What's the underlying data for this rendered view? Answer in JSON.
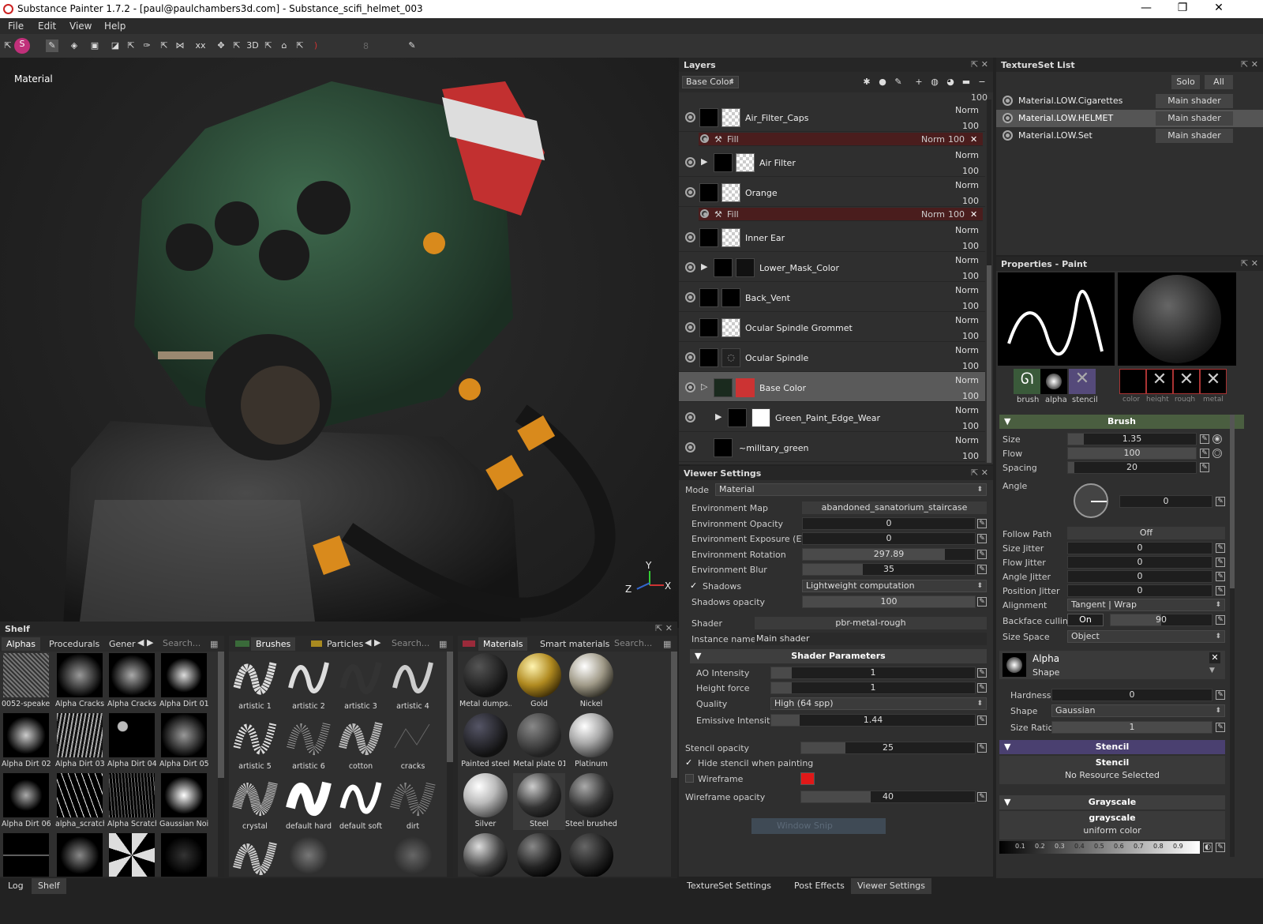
{
  "window": {
    "title": "Substance Painter 1.7.2 - [paul@paulchambers3d.com] - Substance_scifi_helmet_003",
    "minimize": "—",
    "maximize": "❐",
    "close": "✕"
  },
  "menu": [
    "File",
    "Edit",
    "View",
    "Help"
  ],
  "toolbar": {
    "brush_size_value": "8"
  },
  "viewport": {
    "label": "Material",
    "axes": {
      "x": "X",
      "y": "Y",
      "z": "Z"
    }
  },
  "layers": {
    "title": "Layers",
    "channel": "Base Color",
    "top_value": "100",
    "items": [
      {
        "name": "Air_Filter_Caps",
        "blend": "Norm",
        "opacity": "100",
        "fill": {
          "label": "Fill",
          "blend": "Norm",
          "opacity": "100"
        }
      },
      {
        "name": "Air Filter",
        "blend": "Norm",
        "opacity": "100",
        "folder": true
      },
      {
        "name": "Orange",
        "blend": "Norm",
        "opacity": "100",
        "fill": {
          "label": "Fill",
          "blend": "Norm",
          "opacity": "100"
        }
      },
      {
        "name": "Inner Ear",
        "blend": "Norm",
        "opacity": "100"
      },
      {
        "name": "Lower_Mask_Color",
        "blend": "Norm",
        "opacity": "100",
        "folder": true
      },
      {
        "name": "Back_Vent",
        "blend": "Norm",
        "opacity": "100"
      },
      {
        "name": "Ocular Spindle Grommet",
        "blend": "Norm",
        "opacity": "100"
      },
      {
        "name": "Ocular Spindle",
        "blend": "Norm",
        "opacity": "100"
      },
      {
        "name": "Base Color",
        "blend": "Norm",
        "opacity": "100",
        "folder": true,
        "selected": true
      },
      {
        "name": "Green_Paint_Edge_Wear",
        "blend": "Norm",
        "opacity": "100",
        "folder": true
      },
      {
        "name": "~military_green",
        "blend": "Norm",
        "opacity": "100"
      }
    ]
  },
  "textureset": {
    "title": "TextureSet List",
    "solo": "Solo",
    "all": "All",
    "items": [
      {
        "name": "Material.LOW.Cigarettes",
        "shader": "Main shader"
      },
      {
        "name": "Material.LOW.HELMET",
        "shader": "Main shader",
        "selected": true
      },
      {
        "name": "Material.LOW.Set",
        "shader": "Main shader"
      }
    ]
  },
  "properties": {
    "title": "Properties - Paint",
    "slots": [
      "brush",
      "alpha",
      "stencil"
    ],
    "material_slots": [
      "color",
      "height",
      "rough",
      "metal"
    ],
    "brush_section": "Brush",
    "size": {
      "label": "Size",
      "value": "1.35"
    },
    "flow": {
      "label": "Flow",
      "value": "100"
    },
    "spacing": {
      "label": "Spacing",
      "value": "20"
    },
    "angle": {
      "label": "Angle",
      "value": "0"
    },
    "follow_path": {
      "label": "Follow Path",
      "value": "Off"
    },
    "size_jitter": {
      "label": "Size Jitter",
      "value": "0"
    },
    "flow_jitter": {
      "label": "Flow Jitter",
      "value": "0"
    },
    "angle_jitter": {
      "label": "Angle Jitter",
      "value": "0"
    },
    "position_jitter": {
      "label": "Position Jitter",
      "value": "0"
    },
    "alignment": {
      "label": "Alignment",
      "value": "Tangent | Wrap"
    },
    "backface": {
      "label": "Backface culling",
      "toggle": "On",
      "value": "90"
    },
    "size_space": {
      "label": "Size Space",
      "value": "Object"
    },
    "alpha": {
      "title": "Alpha",
      "subtitle": "Shape"
    },
    "hardness": {
      "label": "Hardness",
      "value": "0"
    },
    "shape": {
      "label": "Shape",
      "value": "Gaussian"
    },
    "size_ratio": {
      "label": "Size Ratio",
      "value": "1"
    },
    "stencil_section": "Stencil",
    "stencil_title": "Stencil",
    "stencil_none": "No Resource Selected",
    "grayscale_section": "Grayscale",
    "grayscale_title": "grayscale",
    "grayscale_sub": "uniform color",
    "ramp_ticks": [
      "0.1",
      "0.2",
      "0.3",
      "0.4",
      "0.5",
      "0.6",
      "0.7",
      "0.8",
      "0.9"
    ]
  },
  "viewer": {
    "title": "Viewer Settings",
    "mode": {
      "label": "Mode",
      "value": "Material"
    },
    "env_map": {
      "label": "Environment Map",
      "value": "abandoned_sanatorium_staircase"
    },
    "env_opacity": {
      "label": "Environment Opacity",
      "value": "0"
    },
    "env_exposure": {
      "label": "Environment Exposure (EV)",
      "value": "0"
    },
    "env_rotation": {
      "label": "Environment Rotation",
      "value": "297.89"
    },
    "env_blur": {
      "label": "Environment Blur",
      "value": "35"
    },
    "shadows": {
      "label": "Shadows",
      "value": "Lightweight computation"
    },
    "shadows_opacity": {
      "label": "Shadows opacity",
      "value": "100"
    },
    "shader": {
      "label": "Shader",
      "value": "pbr-metal-rough"
    },
    "instance": {
      "label": "Instance name",
      "value": "Main shader"
    },
    "shader_params": "Shader Parameters",
    "ao": {
      "label": "AO Intensity",
      "value": "1"
    },
    "height": {
      "label": "Height force",
      "value": "1"
    },
    "quality": {
      "label": "Quality",
      "value": "High (64 spp)"
    },
    "emissive": {
      "label": "Emissive Intensity",
      "value": "1.44"
    },
    "stencil_opacity": {
      "label": "Stencil opacity",
      "value": "25"
    },
    "hide_stencil": {
      "label": "Hide stencil when painting"
    },
    "wireframe": {
      "label": "Wireframe"
    },
    "wireframe_opacity": {
      "label": "Wireframe opacity",
      "value": "40"
    },
    "snip": "Window Snip"
  },
  "shelf": {
    "title": "Shelf",
    "tabs1": [
      "Alphas",
      "Procedurals",
      "Gener"
    ],
    "tabs2": [
      "Brushes",
      "Particles"
    ],
    "tabs3": [
      "Materials",
      "Smart materials"
    ],
    "search": "Search...",
    "alphas": [
      "0052-speake...",
      "Alpha Cracks ...",
      "Alpha Cracks ...",
      "Alpha Dirt 01",
      "Alpha Dirt 02",
      "Alpha Dirt 03",
      "Alpha Dirt 04",
      "Alpha Dirt 05",
      "Alpha Dirt 06",
      "alpha_scratch...",
      "Alpha Scratch...",
      "Gaussian Noise"
    ],
    "brushes": [
      "artistic 1",
      "artistic 2",
      "artistic 3",
      "artistic 4",
      "artistic 5",
      "artistic 6",
      "cotton",
      "cracks",
      "crystal",
      "default hard",
      "default soft",
      "dirt"
    ],
    "materials": [
      "Metal dumps...",
      "Gold",
      "Nickel",
      "Painted steel",
      "Metal plate 011",
      "Platinum",
      "Silver",
      "Steel",
      "Steel brushed"
    ]
  },
  "bottom_tabs_left": [
    "Log",
    "Shelf"
  ],
  "bottom_tabs_right": [
    "TextureSet Settings",
    "Post Effects",
    "Viewer Settings"
  ]
}
